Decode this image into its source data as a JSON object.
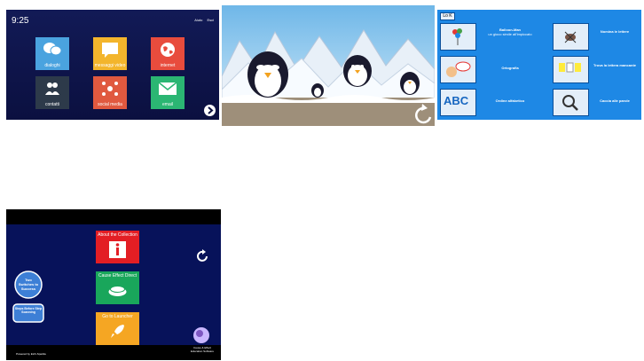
{
  "s1": {
    "time": "9:25",
    "header_links": [
      "Aiuto",
      "Esci"
    ],
    "tiles": [
      {
        "label": "dialoghi",
        "color": "#4aa3df"
      },
      {
        "label": "messaggi video",
        "color": "#f3b52c"
      },
      {
        "label": "internet",
        "color": "#e84c3d"
      },
      {
        "label": "contatti",
        "color": "#2d3a4a"
      },
      {
        "label": "social media",
        "color": "#e0593f"
      },
      {
        "label": "email",
        "color": "#2bb673"
      }
    ]
  },
  "s3": {
    "back_label": "Lo K",
    "items": [
      {
        "title": "Balloon-Man",
        "sub": "un gioco simile all'impiccato"
      },
      {
        "title": "Ortografia",
        "sub": ""
      },
      {
        "title": "Ordine alfabetico",
        "sub": ""
      },
      {
        "title": "Nomina le lettere",
        "sub": ""
      },
      {
        "title": "Trova la lettera mancante",
        "sub": ""
      },
      {
        "title": "Caccia alle parole",
        "sub": ""
      }
    ],
    "abc": "ABC"
  },
  "s4": {
    "buttons": [
      {
        "label": "About the Collection",
        "color": "#e31e24"
      },
      {
        "label": "Cause Effect Direct",
        "color": "#19a65b"
      },
      {
        "label": "Go to Launcher",
        "color": "#f5a623"
      }
    ],
    "logo_top": "Two Switches to Success",
    "logo_bottom": "Steps Before Step Scanning",
    "credits_left": "Powered by Etch-Sparkle",
    "credits_right": "Cause & Effect Education Software"
  }
}
